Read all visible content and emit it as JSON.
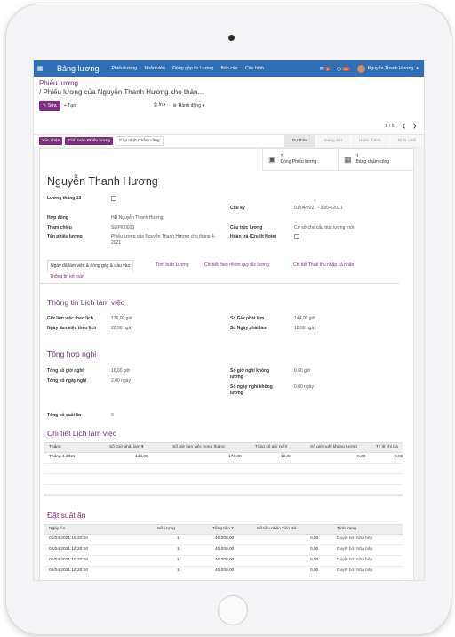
{
  "navbar": {
    "app_title": "Bảng lương",
    "menu": [
      "Phiếu lương",
      "Nhân viên",
      "Đóng góp từ Lương",
      "Báo cáo",
      "Cấu hình"
    ],
    "messages_count": "6",
    "activities_count": "20",
    "user_name": "Nguyễn Thanh Hương",
    "brand_color": "#2f6fb6",
    "accent_color": "#7c2f7d"
  },
  "breadcrumb": {
    "parent": "Phiếu lương",
    "current": "/ Phiếu lương của Nguyễn Thanh Hương cho thán..."
  },
  "toolbar": {
    "edit_label": "Sửa",
    "create_label": "Tạo",
    "print_label": "In",
    "action_label": "Hành động",
    "pager": "1 / 6"
  },
  "statusbar": {
    "confirm_label": "Xác nhận",
    "compute_label": "Tính toán Phiếu lương",
    "update_label": "Cập nhật Chấm công",
    "stages": [
      "Dự thảo",
      "Đang đợi",
      "Hoàn thành",
      "Bị từ chối"
    ]
  },
  "smart_buttons": {
    "payslip_count": "7",
    "payslip_label": "Dòng Phiếu lương",
    "timesheet_count": "3",
    "timesheet_label": "Bảng chấm công"
  },
  "employee_name": "Nguyễn Thanh Hương",
  "fields": {
    "salary13_label": "Lương tháng 13",
    "period_label": "Chu kỳ",
    "period_value": "01/04/2021 - 30/04/2021",
    "contract_label": "Hợp đồng",
    "contract_value": "HĐ Nguyễn Thanh Hương",
    "ref_label": "Tham chiếu",
    "ref_value": "SLIP/00023",
    "structure_label": "Cấu trúc lương",
    "structure_value": "Cơ sở cho cấu trúc lương mới",
    "name_label": "Tên phiếu lương",
    "name_value": "Phiếu lương của Nguyễn Thanh Hương cho tháng 4-2021",
    "refund_label": "Hoàn trả (Credit Note)"
  },
  "tabs": [
    "Ngày đã làm việc & đóng góp & đầu vào",
    "Tính toán Lương",
    "Chi tiết theo nhóm quy tắc lương",
    "Chi tiết Thuế thu nhập cá nhân",
    "Thông tin kế toán"
  ],
  "work_schedule": {
    "title": "Thông tin Lịch làm việc",
    "hours_label": "Giờ làm việc theo lịch",
    "hours_value": "176,00 giờ",
    "days_label": "Ngày làm việc theo lịch",
    "days_value": "22,00 ngày",
    "req_hours_label": "Số Giờ phải làm",
    "req_hours_value": "144,00 giờ",
    "req_days_label": "Số Ngày phải làm",
    "req_days_value": "18,00 ngày"
  },
  "leave_summary": {
    "title": "Tổng hợp nghỉ",
    "leave_hours_label": "Tổng số giờ nghỉ",
    "leave_hours_value": "16,00 giờ",
    "leave_days_label": "Tổng số ngày nghỉ",
    "leave_days_value": "2,00 ngày",
    "unpaid_hours_label": "Số giờ nghỉ không lương",
    "unpaid_hours_value": "0,00 giờ",
    "unpaid_days_label": "Số ngày nghỉ không lương",
    "unpaid_days_value": "0,00 ngày",
    "meals_label": "Tổng số suất ăn",
    "meals_value": "9"
  },
  "schedule_table": {
    "title": "Chi tiết Lịch làm việc",
    "headers": [
      "Tháng",
      "Số Giờ phải làm ▾",
      "Số giờ làm việc trong tháng",
      "Tổng số giờ nghỉ",
      "Số giờ nghỉ không lương",
      "Tỷ lệ chi trả"
    ],
    "rows": [
      [
        "Tháng 4 2021",
        "144,00",
        "176,00",
        "16,00",
        "0,00",
        "0,82"
      ]
    ]
  },
  "meals_table": {
    "title": "Đặt suất ăn",
    "headers": [
      "Ngày Ăn",
      "Số lượng",
      "Tổng tiền ▾",
      "Số tiền nhân viên trả",
      "Tình trạng"
    ],
    "rows": [
      [
        "01/04/2021 19:20:00",
        "1",
        "40.000,00",
        "0,00",
        "Duyệt bởi Nhà bếp"
      ],
      [
        "02/04/2021 19:20:00",
        "1",
        "40.000,00",
        "0,00",
        "Duyệt bởi Nhà bếp"
      ],
      [
        "05/04/2021 19:20:00",
        "1",
        "40.000,00",
        "0,00",
        "Duyệt bởi Nhà bếp"
      ],
      [
        "06/04/2021 19:20:00",
        "1",
        "40.000,00",
        "0,00",
        "Duyệt bởi Nhà bếp"
      ]
    ]
  }
}
